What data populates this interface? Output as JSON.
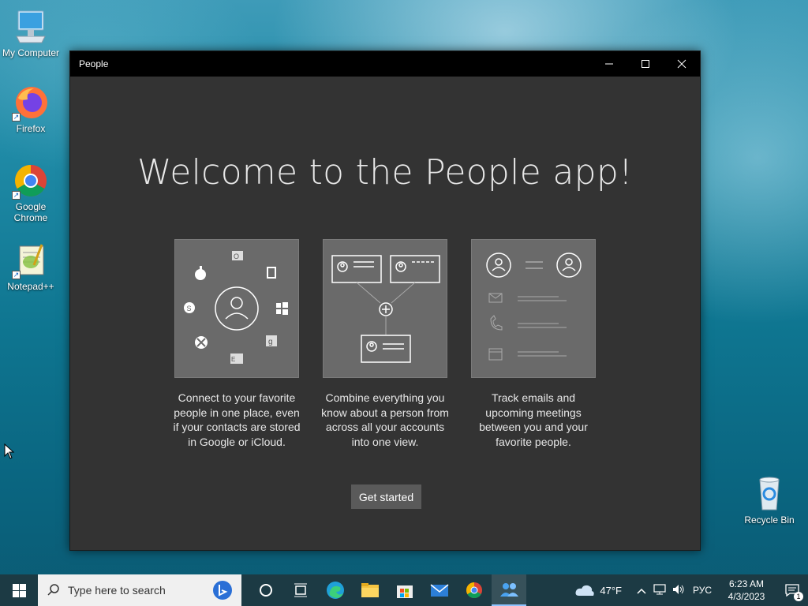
{
  "desktop": {
    "icons": [
      {
        "label": "My Computer"
      },
      {
        "label": "Firefox"
      },
      {
        "label": "Google Chrome"
      },
      {
        "label": "Notepad++"
      },
      {
        "label": "Recycle Bin"
      }
    ]
  },
  "window": {
    "title": "People",
    "welcome": "Welcome to the People app!",
    "cards": [
      {
        "text": "Connect to your favorite people in one place, even if your contacts are stored in Google or iCloud."
      },
      {
        "text": "Combine everything you know about a person from across all your accounts into one view."
      },
      {
        "text": "Track emails and upcoming meetings between you and your favorite people."
      }
    ],
    "get_started": "Get started"
  },
  "taskbar": {
    "search_placeholder": "Type here to search",
    "weather": "47°F",
    "language": "РУС",
    "time": "6:23 AM",
    "date": "4/3/2023",
    "notification_count": "1"
  },
  "colors": {
    "window_bg": "#333333",
    "titlebar_bg": "#000000",
    "card_bg": "#6a6a6a",
    "button_bg": "#5a5a5a",
    "taskbar_bg": "#1c3a44"
  }
}
